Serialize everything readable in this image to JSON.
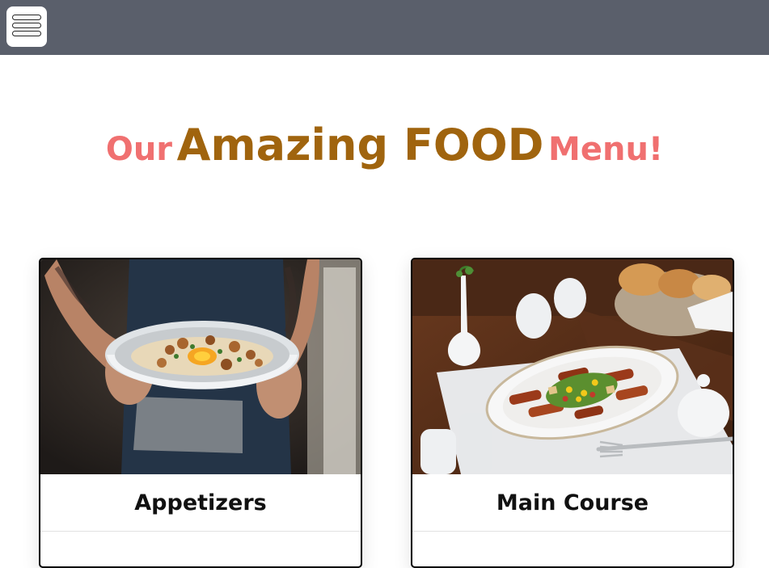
{
  "header": {
    "menu_icon": "hamburger-menu-icon",
    "background_color": "#5a5f6b"
  },
  "headline": {
    "part1": "Our",
    "part2": "Amazing FOOD",
    "part3": "Menu!",
    "accent_color": "#f07070",
    "brand_color": "#a0640e"
  },
  "cards": [
    {
      "title": "Appetizers",
      "image": "bowl-of-food-photo"
    },
    {
      "title": "Main Course",
      "image": "plated-main-course-photo"
    }
  ]
}
